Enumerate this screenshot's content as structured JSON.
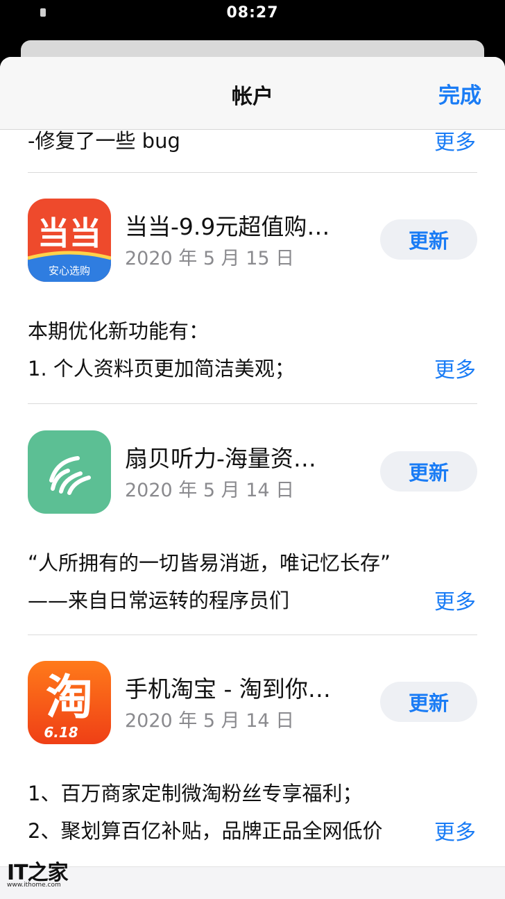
{
  "status_bar": {
    "time": "08:27"
  },
  "nav": {
    "title": "帐户",
    "done_label": "完成"
  },
  "top_note": {
    "line1": "-修复了一些 bug",
    "more": "更多"
  },
  "apps": [
    {
      "name": "当当-9.9元超值购…",
      "date": "2020 年 5 月 15 日",
      "update_label": "更新",
      "icon_name": "dangdang-app-icon",
      "icon_text_main": "当当",
      "icon_text_sub": "安心选购",
      "notes": [
        "本期优化新功能有：",
        "1. 个人资料页更加简洁美观；"
      ],
      "more": "更多"
    },
    {
      "name": "扇贝听力-海量资…",
      "date": "2020 年 5 月 14 日",
      "update_label": "更新",
      "icon_name": "shanbay-listening-app-icon",
      "notes": [
        "“人所拥有的一切皆易消逝，唯记忆长存”",
        "——来自日常运转的程序员们"
      ],
      "more": "更多"
    },
    {
      "name": "手机淘宝 - 淘到你…",
      "date": "2020 年 5 月 14 日",
      "update_label": "更新",
      "icon_name": "taobao-app-icon",
      "icon_text_main": "淘",
      "icon_text_sub": "6.18",
      "notes": [
        "1、百万商家定制微淘粉丝专享福利；",
        "2、聚划算百亿补贴，品牌正品全网低价"
      ],
      "more": "更多"
    }
  ],
  "watermark": {
    "logo": "IT之家",
    "url": "www.ithome.com"
  },
  "colors": {
    "accent": "#1a7cf5",
    "dangdang_red": "#ee4a2c",
    "shanbay_green": "#5cbf94",
    "taobao_orange": "#f35b19"
  }
}
